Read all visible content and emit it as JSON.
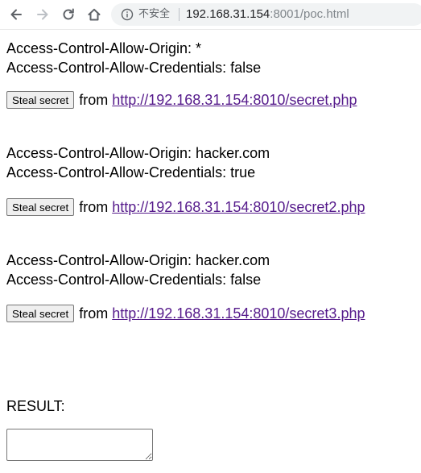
{
  "browser": {
    "security_label": "不安全",
    "url_host": "192.168.31.154",
    "url_rest": ":8001/poc.html"
  },
  "page": {
    "blocks": [
      {
        "origin_line": "Access-Control-Allow-Origin: *",
        "credentials_line": "Access-Control-Allow-Credentials: false",
        "button_label": "Steal secret",
        "from_text": "from",
        "link_text": "http://192.168.31.154:8010/secret.php"
      },
      {
        "origin_line": "Access-Control-Allow-Origin: hacker.com",
        "credentials_line": "Access-Control-Allow-Credentials: true",
        "button_label": "Steal secret",
        "from_text": "from",
        "link_text": "http://192.168.31.154:8010/secret2.php"
      },
      {
        "origin_line": "Access-Control-Allow-Origin: hacker.com",
        "credentials_line": "Access-Control-Allow-Credentials: false",
        "button_label": "Steal secret",
        "from_text": "from",
        "link_text": "http://192.168.31.154:8010/secret3.php"
      }
    ],
    "result_label": "RESULT:",
    "result_value": ""
  },
  "icons": {
    "back": "arrow-left-icon",
    "forward": "arrow-right-icon",
    "reload": "reload-icon",
    "home": "home-icon",
    "info": "info-icon"
  },
  "colors": {
    "link_visited": "#551a8b",
    "omnibox_bg": "#f1f3f4"
  }
}
